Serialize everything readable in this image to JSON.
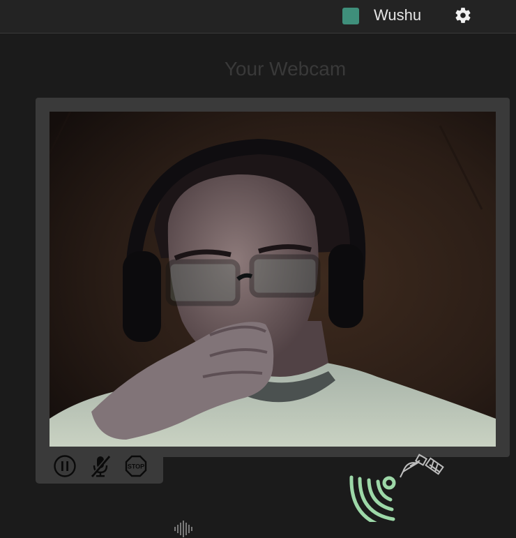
{
  "header": {
    "user_name": "Wushu",
    "user_color": "#3f8f7b",
    "settings_icon": "gear-icon"
  },
  "webcam": {
    "title": "Your Webcam",
    "content": "webcam-video-feed"
  },
  "controls": {
    "pause_icon": "pause-icon",
    "mute_icon": "microphone-muted-icon",
    "stop_icon": "stop-sign-icon",
    "stop_label": "STOP"
  },
  "status": {
    "signal_icon": "wireless-signal-icon",
    "signal_color": "#9dd8a8",
    "satellite_icon": "satellite-icon",
    "equalizer_icon": "audio-equalizer-icon"
  }
}
